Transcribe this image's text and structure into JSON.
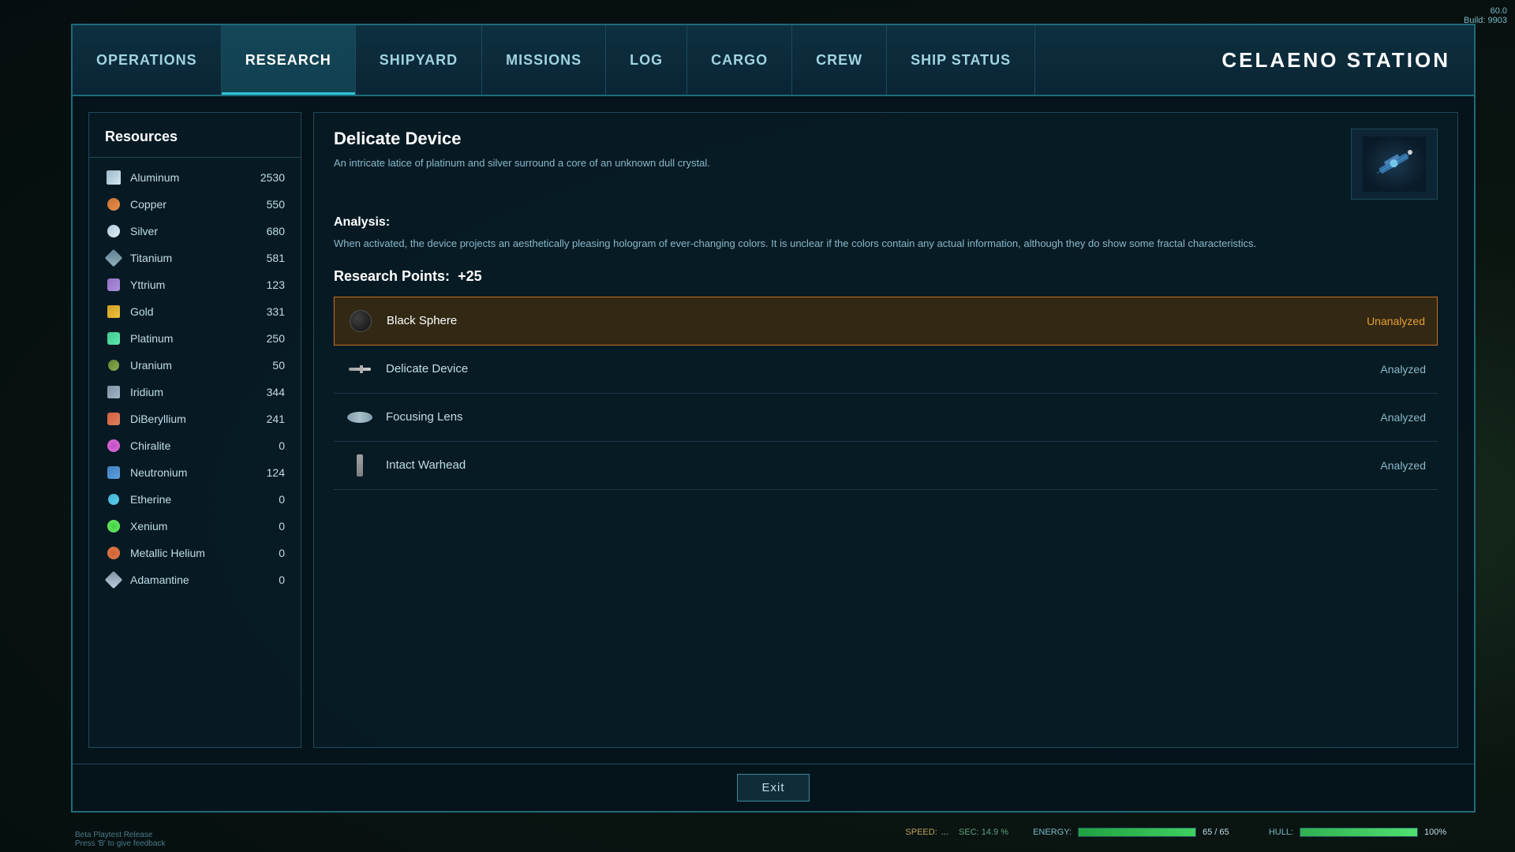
{
  "corner": {
    "fps": "60.0",
    "build": "Build: 9903"
  },
  "nav": {
    "tabs": [
      {
        "id": "operations",
        "label": "Operations",
        "active": false
      },
      {
        "id": "research",
        "label": "Research",
        "active": true
      },
      {
        "id": "shipyard",
        "label": "Shipyard",
        "active": false
      },
      {
        "id": "missions",
        "label": "Missions",
        "active": false
      },
      {
        "id": "log",
        "label": "Log",
        "active": false
      },
      {
        "id": "cargo",
        "label": "Cargo",
        "active": false
      },
      {
        "id": "crew",
        "label": "Crew",
        "active": false
      },
      {
        "id": "ship_status",
        "label": "Ship Status",
        "active": false
      }
    ],
    "station_title": "CELAENO STATION"
  },
  "resources": {
    "title": "Resources",
    "items": [
      {
        "id": "aluminum",
        "name": "Aluminum",
        "amount": "2530"
      },
      {
        "id": "copper",
        "name": "Copper",
        "amount": "550"
      },
      {
        "id": "silver",
        "name": "Silver",
        "amount": "680"
      },
      {
        "id": "titanium",
        "name": "Titanium",
        "amount": "581"
      },
      {
        "id": "yttrium",
        "name": "Yttrium",
        "amount": "123"
      },
      {
        "id": "gold",
        "name": "Gold",
        "amount": "331"
      },
      {
        "id": "platinum",
        "name": "Platinum",
        "amount": "250"
      },
      {
        "id": "uranium",
        "name": "Uranium",
        "amount": "50"
      },
      {
        "id": "iridium",
        "name": "Iridium",
        "amount": "344"
      },
      {
        "id": "diberyllium",
        "name": "DiBeryllium",
        "amount": "241"
      },
      {
        "id": "chiralite",
        "name": "Chiralite",
        "amount": "0"
      },
      {
        "id": "neutronium",
        "name": "Neutronium",
        "amount": "124"
      },
      {
        "id": "etherine",
        "name": "Etherine",
        "amount": "0"
      },
      {
        "id": "xenium",
        "name": "Xenium",
        "amount": "0"
      },
      {
        "id": "metallic_helium",
        "name": "Metallic Helium",
        "amount": "0"
      },
      {
        "id": "adamantine",
        "name": "Adamantine",
        "amount": "0"
      }
    ]
  },
  "detail": {
    "item_title": "Delicate Device",
    "item_description": "An intricate latice of platinum and silver surround a core of an unknown dull crystal.",
    "analysis_title": "Analysis:",
    "analysis_text": "When activated, the device projects an aesthetically pleasing hologram of ever-changing colors. It is unclear if the colors contain any actual information, although they do show some fractal characteristics.",
    "research_points_label": "Research Points:",
    "research_points_value": "+25"
  },
  "items_list": [
    {
      "id": "black_sphere",
      "name": "Black Sphere",
      "status": "Unanalyzed",
      "selected": true
    },
    {
      "id": "delicate_device",
      "name": "Delicate Device",
      "status": "Analyzed",
      "selected": false
    },
    {
      "id": "focusing_lens",
      "name": "Focusing Lens",
      "status": "Analyzed",
      "selected": false
    },
    {
      "id": "intact_warhead",
      "name": "Intact Warhead",
      "status": "Analyzed",
      "selected": false
    }
  ],
  "footer": {
    "exit_label": "Exit"
  },
  "status": {
    "energy_label": "ENERGY:",
    "energy_value": "65 / 65",
    "energy_pct": 100,
    "hull_label": "HULL:",
    "hull_value": "100%",
    "hull_pct": 100
  },
  "beta": {
    "line1": "Beta Playtest Release",
    "line2": "Press 'B' to give feedback"
  }
}
